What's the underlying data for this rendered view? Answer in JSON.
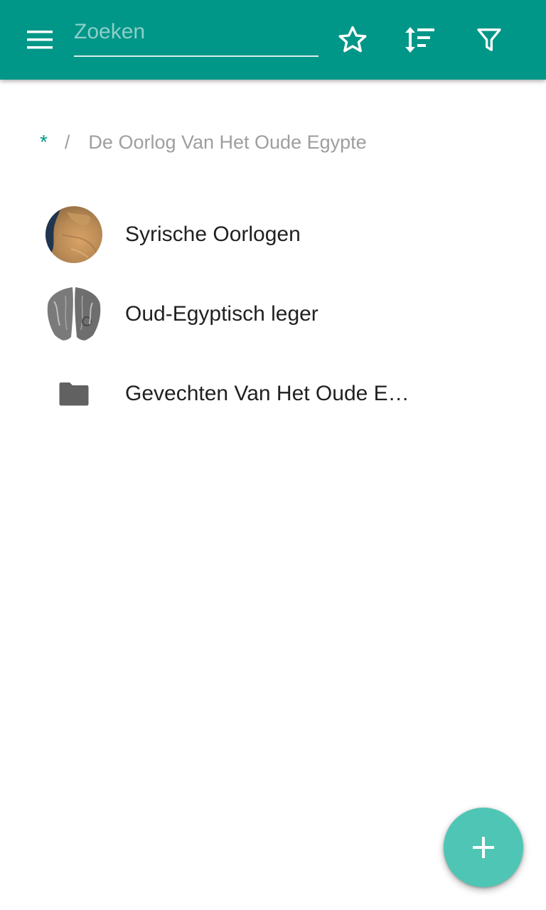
{
  "appbar": {
    "background_color": "#009688",
    "menu_icon": "menu-icon",
    "search": {
      "placeholder": "Zoeken",
      "value": ""
    },
    "actions": [
      {
        "icon": "star-outline-icon"
      },
      {
        "icon": "sort-icon"
      },
      {
        "icon": "filter-icon"
      }
    ]
  },
  "breadcrumb": {
    "root": "*",
    "separator": "/",
    "current": "De Oorlog Van Het Oude Egypte"
  },
  "list": {
    "items": [
      {
        "label": "Syrische Oorlogen",
        "thumbnail": "satellite-map-image"
      },
      {
        "label": "Oud-Egyptisch leger",
        "thumbnail": "palette-relief-image"
      },
      {
        "label": "Gevechten Van Het Oude Egypte",
        "thumbnail": "folder-icon"
      }
    ]
  },
  "fab": {
    "icon": "plus-icon",
    "color": "#4fc6b5"
  }
}
